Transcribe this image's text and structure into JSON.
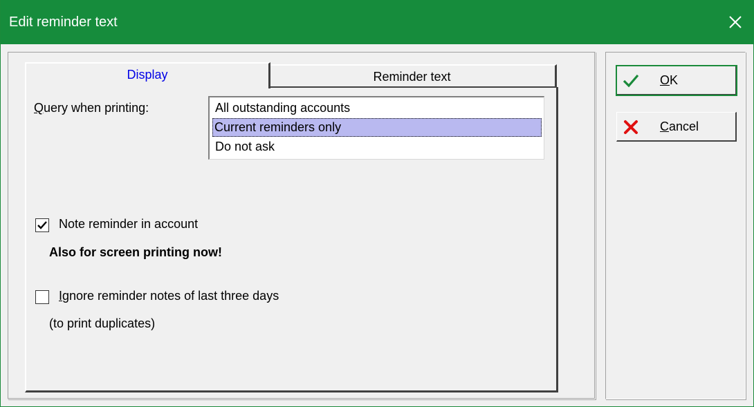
{
  "window": {
    "title": "Edit reminder text",
    "title_bar_color": "#168c3c"
  },
  "tabs": [
    {
      "label": "Display",
      "active": true
    },
    {
      "label": "Reminder text",
      "active": false
    }
  ],
  "query": {
    "label_first": "Q",
    "label_rest": "uery when printing:",
    "options": [
      "All outstanding accounts",
      "Current reminders only",
      "Do not ask"
    ],
    "selected": "Current reminders only"
  },
  "note_reminder": {
    "label": "Note reminder in account",
    "checked": true
  },
  "notice": "Also for screen printing now!",
  "ignore_notes": {
    "label_first": "I",
    "label_rest": "gnore reminder notes of last three days",
    "checked": false
  },
  "duplicates_hint": "(to print duplicates)",
  "buttons": {
    "ok_first": "O",
    "ok_rest": "K",
    "cancel_first": "C",
    "cancel_rest": "ancel"
  },
  "icons": {
    "close": "close-icon",
    "ok": "checkmark-icon",
    "cancel": "cross-icon",
    "checkbox_check": "checkmark-icon"
  }
}
